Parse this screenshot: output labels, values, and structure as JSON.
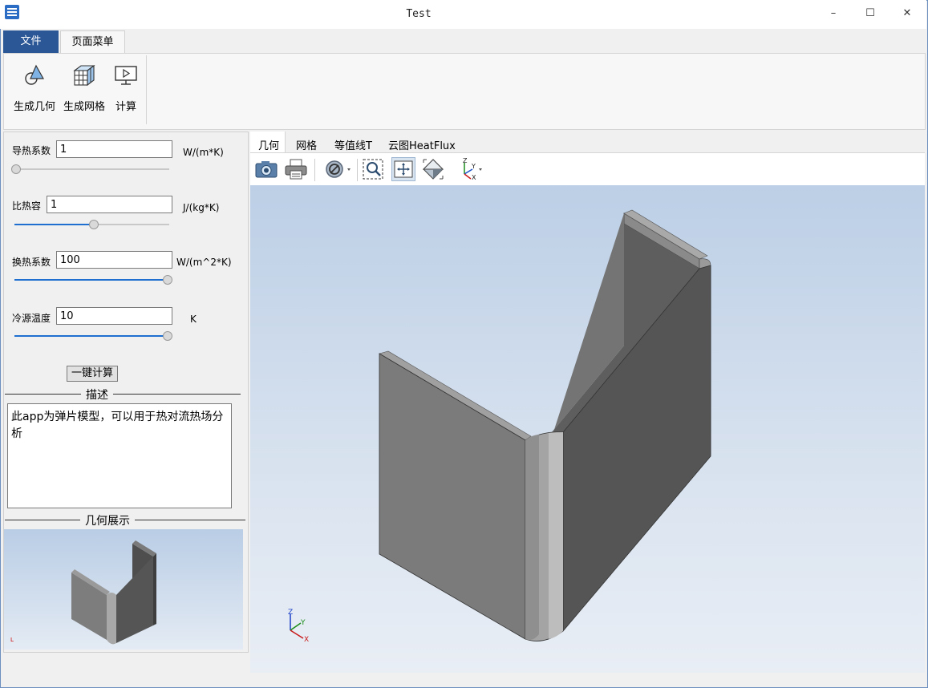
{
  "window": {
    "title": "Test",
    "controls": {
      "minimize": "–",
      "maximize": "☐",
      "close": "✕"
    }
  },
  "ribbon": {
    "tabs": [
      {
        "label": "文件",
        "active": false
      },
      {
        "label": "页面菜单",
        "active": true
      }
    ],
    "buttons": [
      {
        "label": "生成几何",
        "icon": "geometry-icon"
      },
      {
        "label": "生成网格",
        "icon": "mesh-icon"
      },
      {
        "label": "计算",
        "icon": "compute-icon"
      }
    ]
  },
  "params": [
    {
      "label": "导热系数",
      "value": "1",
      "unit": "W/(m*K)",
      "slider_fraction": 0.0
    },
    {
      "label": "比热容",
      "value": "1",
      "unit": "J/(kg*K)",
      "slider_fraction": 0.5
    },
    {
      "label": "换热系数",
      "value": "100",
      "unit": "W/(m^2*K)",
      "slider_fraction": 1.0
    },
    {
      "label": "冷源温度",
      "value": "10",
      "unit": "K",
      "slider_fraction": 1.0
    }
  ],
  "calc_button": "一键计算",
  "description": {
    "title": "描述",
    "text": "此app为弹片模型，可以用于热对流热场分析"
  },
  "geometry_display": {
    "title": "几何展示"
  },
  "view_tabs": [
    "几何",
    "网格",
    "等值线T",
    "云图HeatFlux"
  ],
  "toolbar_icons": [
    "camera-icon",
    "print-icon",
    "hide-icon",
    "zoom-box-icon",
    "zoom-fit-icon",
    "iso-view-icon",
    "axis-view-icon"
  ],
  "axis": {
    "x": "X",
    "y": "Y",
    "z": "Z"
  },
  "colors": {
    "accent": "#2b5797",
    "slider": "#1f6fd1",
    "model_light": "#8a8a8a",
    "model_dark": "#555555"
  }
}
